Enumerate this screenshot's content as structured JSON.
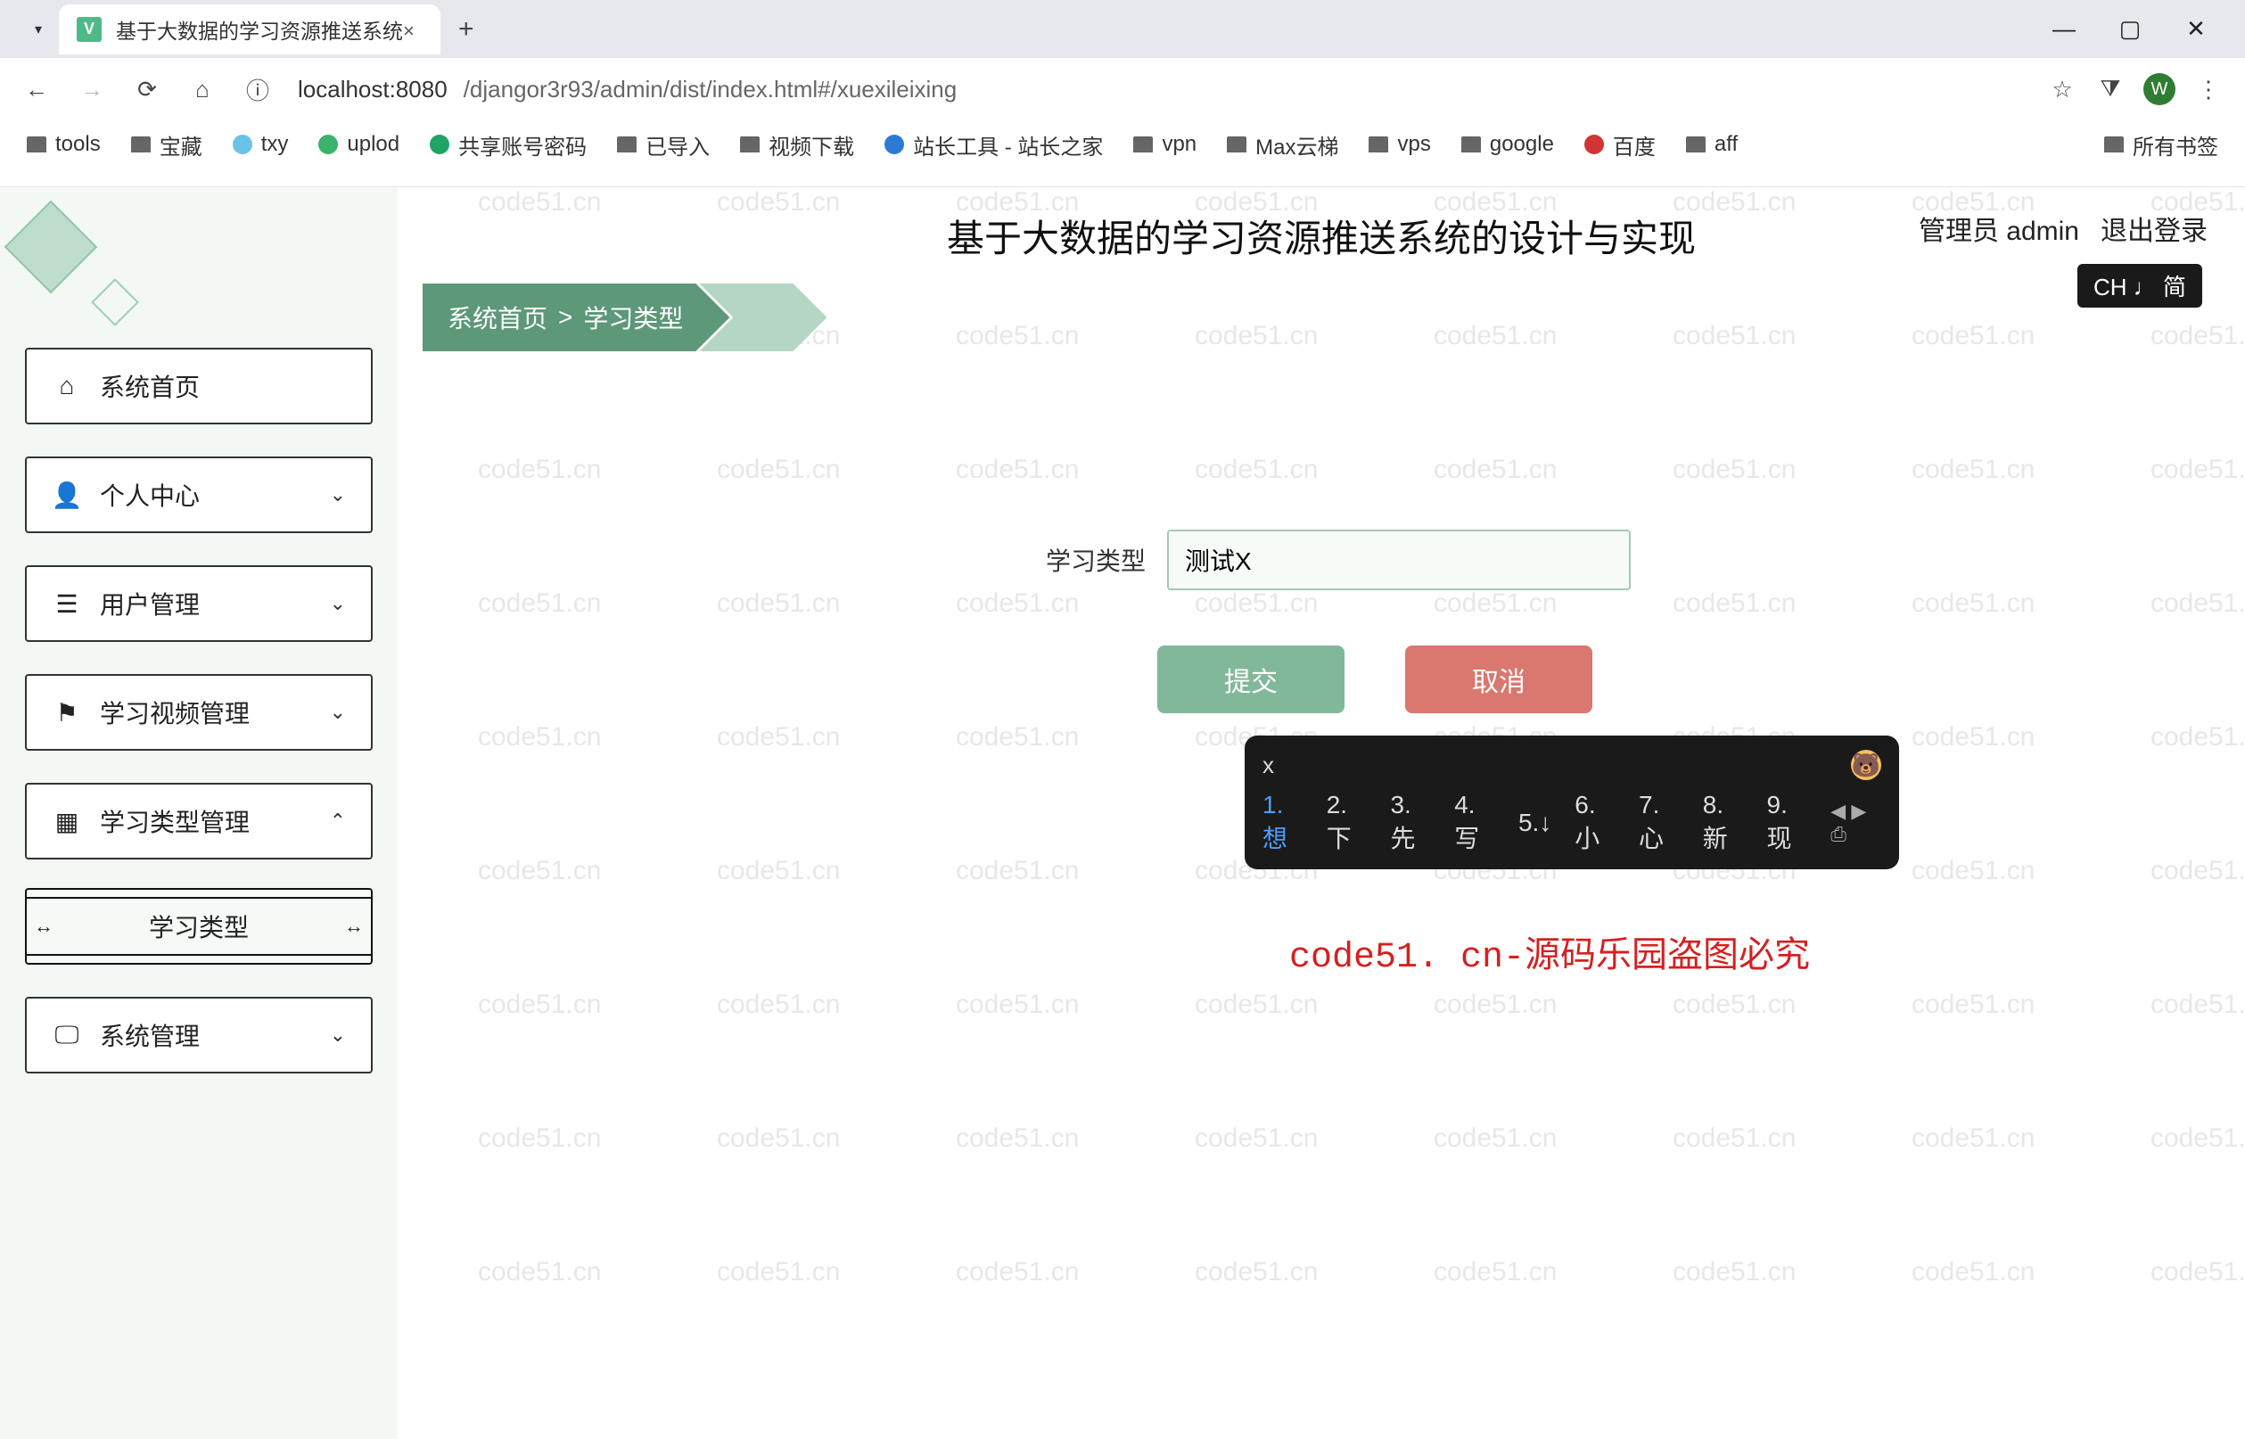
{
  "browser": {
    "tab_title": "基于大数据的学习资源推送系统",
    "url_host": "localhost",
    "url_port": ":8080",
    "url_path": "/djangor3r93/admin/dist/index.html#/xuexileixing",
    "avatar_letter": "W"
  },
  "bookmarks": [
    "tools",
    "宝藏",
    "txy",
    "uplod",
    "共享账号密码",
    "已导入",
    "视频下载",
    "站长工具 - 站长之家",
    "vpn",
    "Max云梯",
    "vps",
    "google",
    "百度",
    "aff"
  ],
  "bookmarks_right": "所有书签",
  "app": {
    "title": "基于大数据的学习资源推送系统的设计与实现",
    "admin_label": "管理员 admin",
    "logout": "退出登录",
    "lang_badge": "CH ♩ 简"
  },
  "breadcrumb": {
    "home": "系统首页",
    "sep": ">",
    "current": "学习类型"
  },
  "sidebar": {
    "items": [
      {
        "label": "系统首页"
      },
      {
        "label": "个人中心"
      },
      {
        "label": "用户管理"
      },
      {
        "label": "学习视频管理"
      },
      {
        "label": "学习类型管理"
      },
      {
        "label": "系统管理"
      }
    ],
    "sub_label": "学习类型"
  },
  "form": {
    "label": "学习类型",
    "value": "测试X",
    "submit": "提交",
    "cancel": "取消"
  },
  "ime": {
    "typed": "x",
    "candidates": [
      "1.想",
      "2.下",
      "3.先",
      "4.写",
      "5.↓",
      "6.小",
      "7.心",
      "8.新",
      "9.现"
    ],
    "nav": "◀ ▶ ⎙"
  },
  "red_watermark": "code51. cn-源码乐园盗图必究",
  "watermark_cell": "code51.cn",
  "colors": {
    "green": "#5d9879",
    "green_light": "#b5d6c4",
    "submit": "#82b89a",
    "cancel": "#d9786f"
  }
}
